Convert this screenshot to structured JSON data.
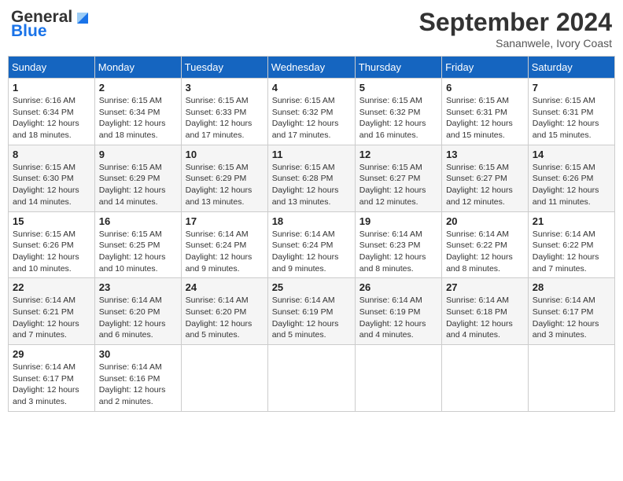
{
  "header": {
    "logo_general": "General",
    "logo_blue": "Blue",
    "month_year": "September 2024",
    "location": "Sananwele, Ivory Coast"
  },
  "days_of_week": [
    "Sunday",
    "Monday",
    "Tuesday",
    "Wednesday",
    "Thursday",
    "Friday",
    "Saturday"
  ],
  "weeks": [
    [
      {
        "day": "1",
        "sunrise": "6:16 AM",
        "sunset": "6:34 PM",
        "daylight": "12 hours and 18 minutes."
      },
      {
        "day": "2",
        "sunrise": "6:15 AM",
        "sunset": "6:34 PM",
        "daylight": "12 hours and 18 minutes."
      },
      {
        "day": "3",
        "sunrise": "6:15 AM",
        "sunset": "6:33 PM",
        "daylight": "12 hours and 17 minutes."
      },
      {
        "day": "4",
        "sunrise": "6:15 AM",
        "sunset": "6:32 PM",
        "daylight": "12 hours and 17 minutes."
      },
      {
        "day": "5",
        "sunrise": "6:15 AM",
        "sunset": "6:32 PM",
        "daylight": "12 hours and 16 minutes."
      },
      {
        "day": "6",
        "sunrise": "6:15 AM",
        "sunset": "6:31 PM",
        "daylight": "12 hours and 15 minutes."
      },
      {
        "day": "7",
        "sunrise": "6:15 AM",
        "sunset": "6:31 PM",
        "daylight": "12 hours and 15 minutes."
      }
    ],
    [
      {
        "day": "8",
        "sunrise": "6:15 AM",
        "sunset": "6:30 PM",
        "daylight": "12 hours and 14 minutes."
      },
      {
        "day": "9",
        "sunrise": "6:15 AM",
        "sunset": "6:29 PM",
        "daylight": "12 hours and 14 minutes."
      },
      {
        "day": "10",
        "sunrise": "6:15 AM",
        "sunset": "6:29 PM",
        "daylight": "12 hours and 13 minutes."
      },
      {
        "day": "11",
        "sunrise": "6:15 AM",
        "sunset": "6:28 PM",
        "daylight": "12 hours and 13 minutes."
      },
      {
        "day": "12",
        "sunrise": "6:15 AM",
        "sunset": "6:27 PM",
        "daylight": "12 hours and 12 minutes."
      },
      {
        "day": "13",
        "sunrise": "6:15 AM",
        "sunset": "6:27 PM",
        "daylight": "12 hours and 12 minutes."
      },
      {
        "day": "14",
        "sunrise": "6:15 AM",
        "sunset": "6:26 PM",
        "daylight": "12 hours and 11 minutes."
      }
    ],
    [
      {
        "day": "15",
        "sunrise": "6:15 AM",
        "sunset": "6:26 PM",
        "daylight": "12 hours and 10 minutes."
      },
      {
        "day": "16",
        "sunrise": "6:15 AM",
        "sunset": "6:25 PM",
        "daylight": "12 hours and 10 minutes."
      },
      {
        "day": "17",
        "sunrise": "6:14 AM",
        "sunset": "6:24 PM",
        "daylight": "12 hours and 9 minutes."
      },
      {
        "day": "18",
        "sunrise": "6:14 AM",
        "sunset": "6:24 PM",
        "daylight": "12 hours and 9 minutes."
      },
      {
        "day": "19",
        "sunrise": "6:14 AM",
        "sunset": "6:23 PM",
        "daylight": "12 hours and 8 minutes."
      },
      {
        "day": "20",
        "sunrise": "6:14 AM",
        "sunset": "6:22 PM",
        "daylight": "12 hours and 8 minutes."
      },
      {
        "day": "21",
        "sunrise": "6:14 AM",
        "sunset": "6:22 PM",
        "daylight": "12 hours and 7 minutes."
      }
    ],
    [
      {
        "day": "22",
        "sunrise": "6:14 AM",
        "sunset": "6:21 PM",
        "daylight": "12 hours and 7 minutes."
      },
      {
        "day": "23",
        "sunrise": "6:14 AM",
        "sunset": "6:20 PM",
        "daylight": "12 hours and 6 minutes."
      },
      {
        "day": "24",
        "sunrise": "6:14 AM",
        "sunset": "6:20 PM",
        "daylight": "12 hours and 5 minutes."
      },
      {
        "day": "25",
        "sunrise": "6:14 AM",
        "sunset": "6:19 PM",
        "daylight": "12 hours and 5 minutes."
      },
      {
        "day": "26",
        "sunrise": "6:14 AM",
        "sunset": "6:19 PM",
        "daylight": "12 hours and 4 minutes."
      },
      {
        "day": "27",
        "sunrise": "6:14 AM",
        "sunset": "6:18 PM",
        "daylight": "12 hours and 4 minutes."
      },
      {
        "day": "28",
        "sunrise": "6:14 AM",
        "sunset": "6:17 PM",
        "daylight": "12 hours and 3 minutes."
      }
    ],
    [
      {
        "day": "29",
        "sunrise": "6:14 AM",
        "sunset": "6:17 PM",
        "daylight": "12 hours and 3 minutes."
      },
      {
        "day": "30",
        "sunrise": "6:14 AM",
        "sunset": "6:16 PM",
        "daylight": "12 hours and 2 minutes."
      },
      null,
      null,
      null,
      null,
      null
    ]
  ]
}
